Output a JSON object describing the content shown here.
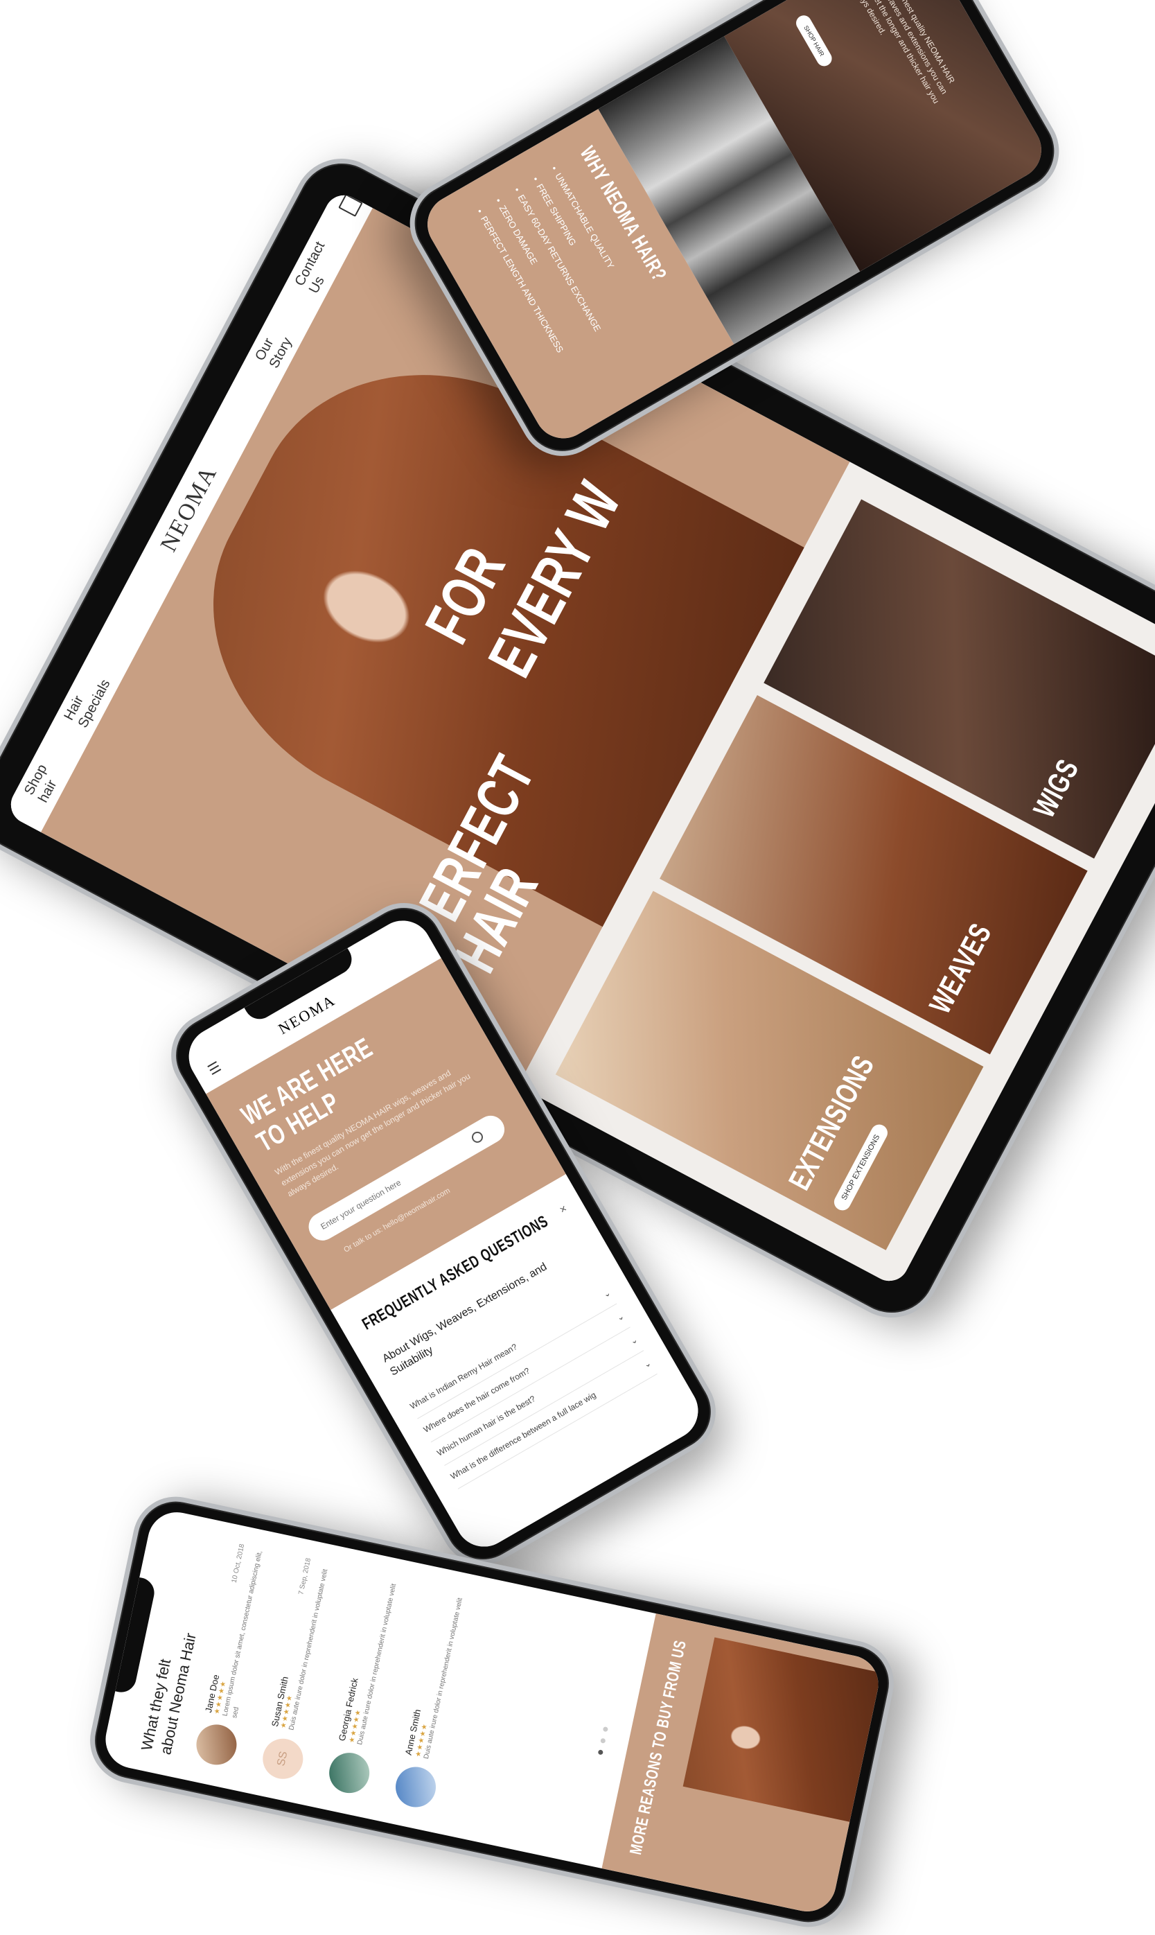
{
  "tablet": {
    "brand": "NEOMA",
    "nav": [
      "Shop hair",
      "Hair Specials",
      "Our Story",
      "Contact Us"
    ],
    "hero_line1": "PERFECT",
    "hero_line2": "HAIR",
    "hero_overlay": "FOR EVERY W",
    "cards": [
      {
        "title": "EXTENSIONS",
        "button": "SHOP EXTENSIONS"
      },
      {
        "title": "WEAVES"
      },
      {
        "title": "WIGS"
      }
    ],
    "cart_icon": "bag-icon"
  },
  "phone_top": {
    "intro": "With the finest quality NEOMA HAIR wigs, weaves and extensions you can now get the longer and thicker hair you always desired.",
    "button": "SHOP HAIR",
    "why_title": "WHY NEOMA HAIR?",
    "reasons": [
      "UNMATCHABLE QUALITY",
      "FREE SHIPPING",
      "EASY 60-DAY RETURNS EXCHANGE",
      "ZERO DAMAGE",
      "PERFECT LENGTH AND THICKNESS"
    ]
  },
  "phone_help": {
    "brand": "NEOMA",
    "title_line1": "WE ARE HERE",
    "title_line2": "TO HELP",
    "body": "With the finest quality NEOMA HAIR wigs, weaves and extensions you can now get the longer and thicker hair you always desired.",
    "search_placeholder": "Enter your question here",
    "talk": "Or talk to us: hello@neomahair.com",
    "faq_title": "FREQUENTLY ASKED QUESTIONS",
    "faq_section": "About Wigs, Weaves, Extensions, and Suitability",
    "questions": [
      "What is Indian Remy Hair mean?",
      "Where does the hair come from?",
      "Which human hair is the best?",
      "What is the difference between a full lace wig"
    ]
  },
  "phone_reviews": {
    "title_line1": "What they felt",
    "title_line2": "about Neoma Hair",
    "reviews": [
      {
        "name": "Jane Doe",
        "date": "10 Oct, 2018",
        "initials": "",
        "text": "Lorem ipsum dolor sit amet, consectetur adipiscing elit, sed"
      },
      {
        "name": "Susan Smith",
        "date": "7 Sep, 2018",
        "initials": "SS",
        "text": "Duis aute irure dolor in reprehenderit in voluptate velit"
      },
      {
        "name": "Georgia Fedrick",
        "date": "",
        "initials": "",
        "text": "Duis aute irure dolor in reprehenderit in voluptate velit"
      },
      {
        "name": "Anne Smith",
        "date": "",
        "initials": "",
        "text": "Duis aute irure dolor in reprehenderit in voluptate velit"
      }
    ],
    "stars": "★★★★★",
    "more_reasons": "MORE REASONS TO BUY FROM US"
  },
  "colors": {
    "tan": "#c89f83",
    "accent": "#d9a441"
  }
}
